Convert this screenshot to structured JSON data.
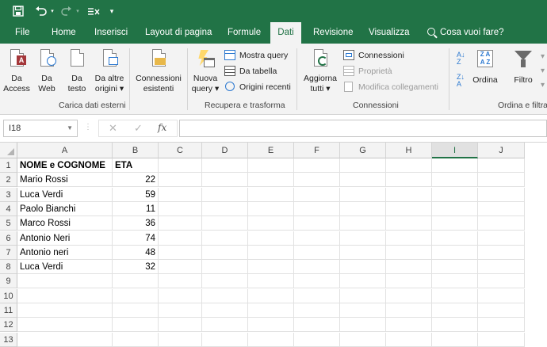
{
  "colors": {
    "brand": "#217346",
    "ribbon_bg": "#f3f3f3",
    "grid_line": "#e1e1e1"
  },
  "quick_access": {
    "save_icon": "save-icon",
    "undo_icon": "undo-icon",
    "redo_icon": "redo-icon",
    "custom_icon": "sort-clear-icon",
    "customize_icon": "chevron-down-icon"
  },
  "tabs": [
    "File",
    "Home",
    "Inserisci",
    "Layout di pagina",
    "Formule",
    "Dati",
    "Revisione",
    "Visualizza"
  ],
  "active_tab": "Dati",
  "tell_me": "Cosa vuoi fare?",
  "ribbon": {
    "carica": {
      "label": "Carica dati esterni",
      "buttons": [
        {
          "line1": "Da",
          "line2": "Access"
        },
        {
          "line1": "Da",
          "line2": "Web"
        },
        {
          "line1": "Da",
          "line2": "testo"
        },
        {
          "line1": "Da altre",
          "line2": "origini ▾"
        }
      ]
    },
    "connessioni_esistenti": {
      "line1": "Connessioni",
      "line2": "esistenti"
    },
    "recupera": {
      "label": "Recupera e trasforma",
      "nuova_line1": "Nuova",
      "nuova_line2": "query ▾",
      "mostra_query": "Mostra query",
      "da_tabella": "Da tabella",
      "origini_recenti": "Origini recenti"
    },
    "connessioni": {
      "label": "Connessioni",
      "aggiorna_line1": "Aggiorna",
      "aggiorna_line2": "tutti ▾",
      "connessioni": "Connessioni",
      "proprieta": "Proprietà",
      "modifica": "Modifica collegamenti"
    },
    "ordina": {
      "label": "Ordina e filtra",
      "ordina": "Ordina",
      "filtro": "Filtro"
    }
  },
  "formula_bar": {
    "name_box": "I18",
    "cancel": "✕",
    "enter": "✓",
    "fx": "fx",
    "formula": ""
  },
  "sheet": {
    "columns": [
      "A",
      "B",
      "C",
      "D",
      "E",
      "F",
      "G",
      "H",
      "I",
      "J"
    ],
    "selected_column": "I",
    "row_numbers": [
      "1",
      "2",
      "3",
      "4",
      "5",
      "6",
      "7",
      "8",
      "9",
      "10",
      "11",
      "12",
      "13"
    ],
    "header": [
      "NOME e COGNOME",
      "ETA"
    ],
    "rows": [
      [
        "Mario Rossi",
        "22"
      ],
      [
        "Luca Verdi",
        "59"
      ],
      [
        "Paolo Bianchi",
        "11"
      ],
      [
        "Marco Rossi",
        "36"
      ],
      [
        "Antonio Neri",
        "74"
      ],
      [
        "Antonio neri",
        "48"
      ],
      [
        "Luca Verdi",
        "32"
      ]
    ]
  }
}
